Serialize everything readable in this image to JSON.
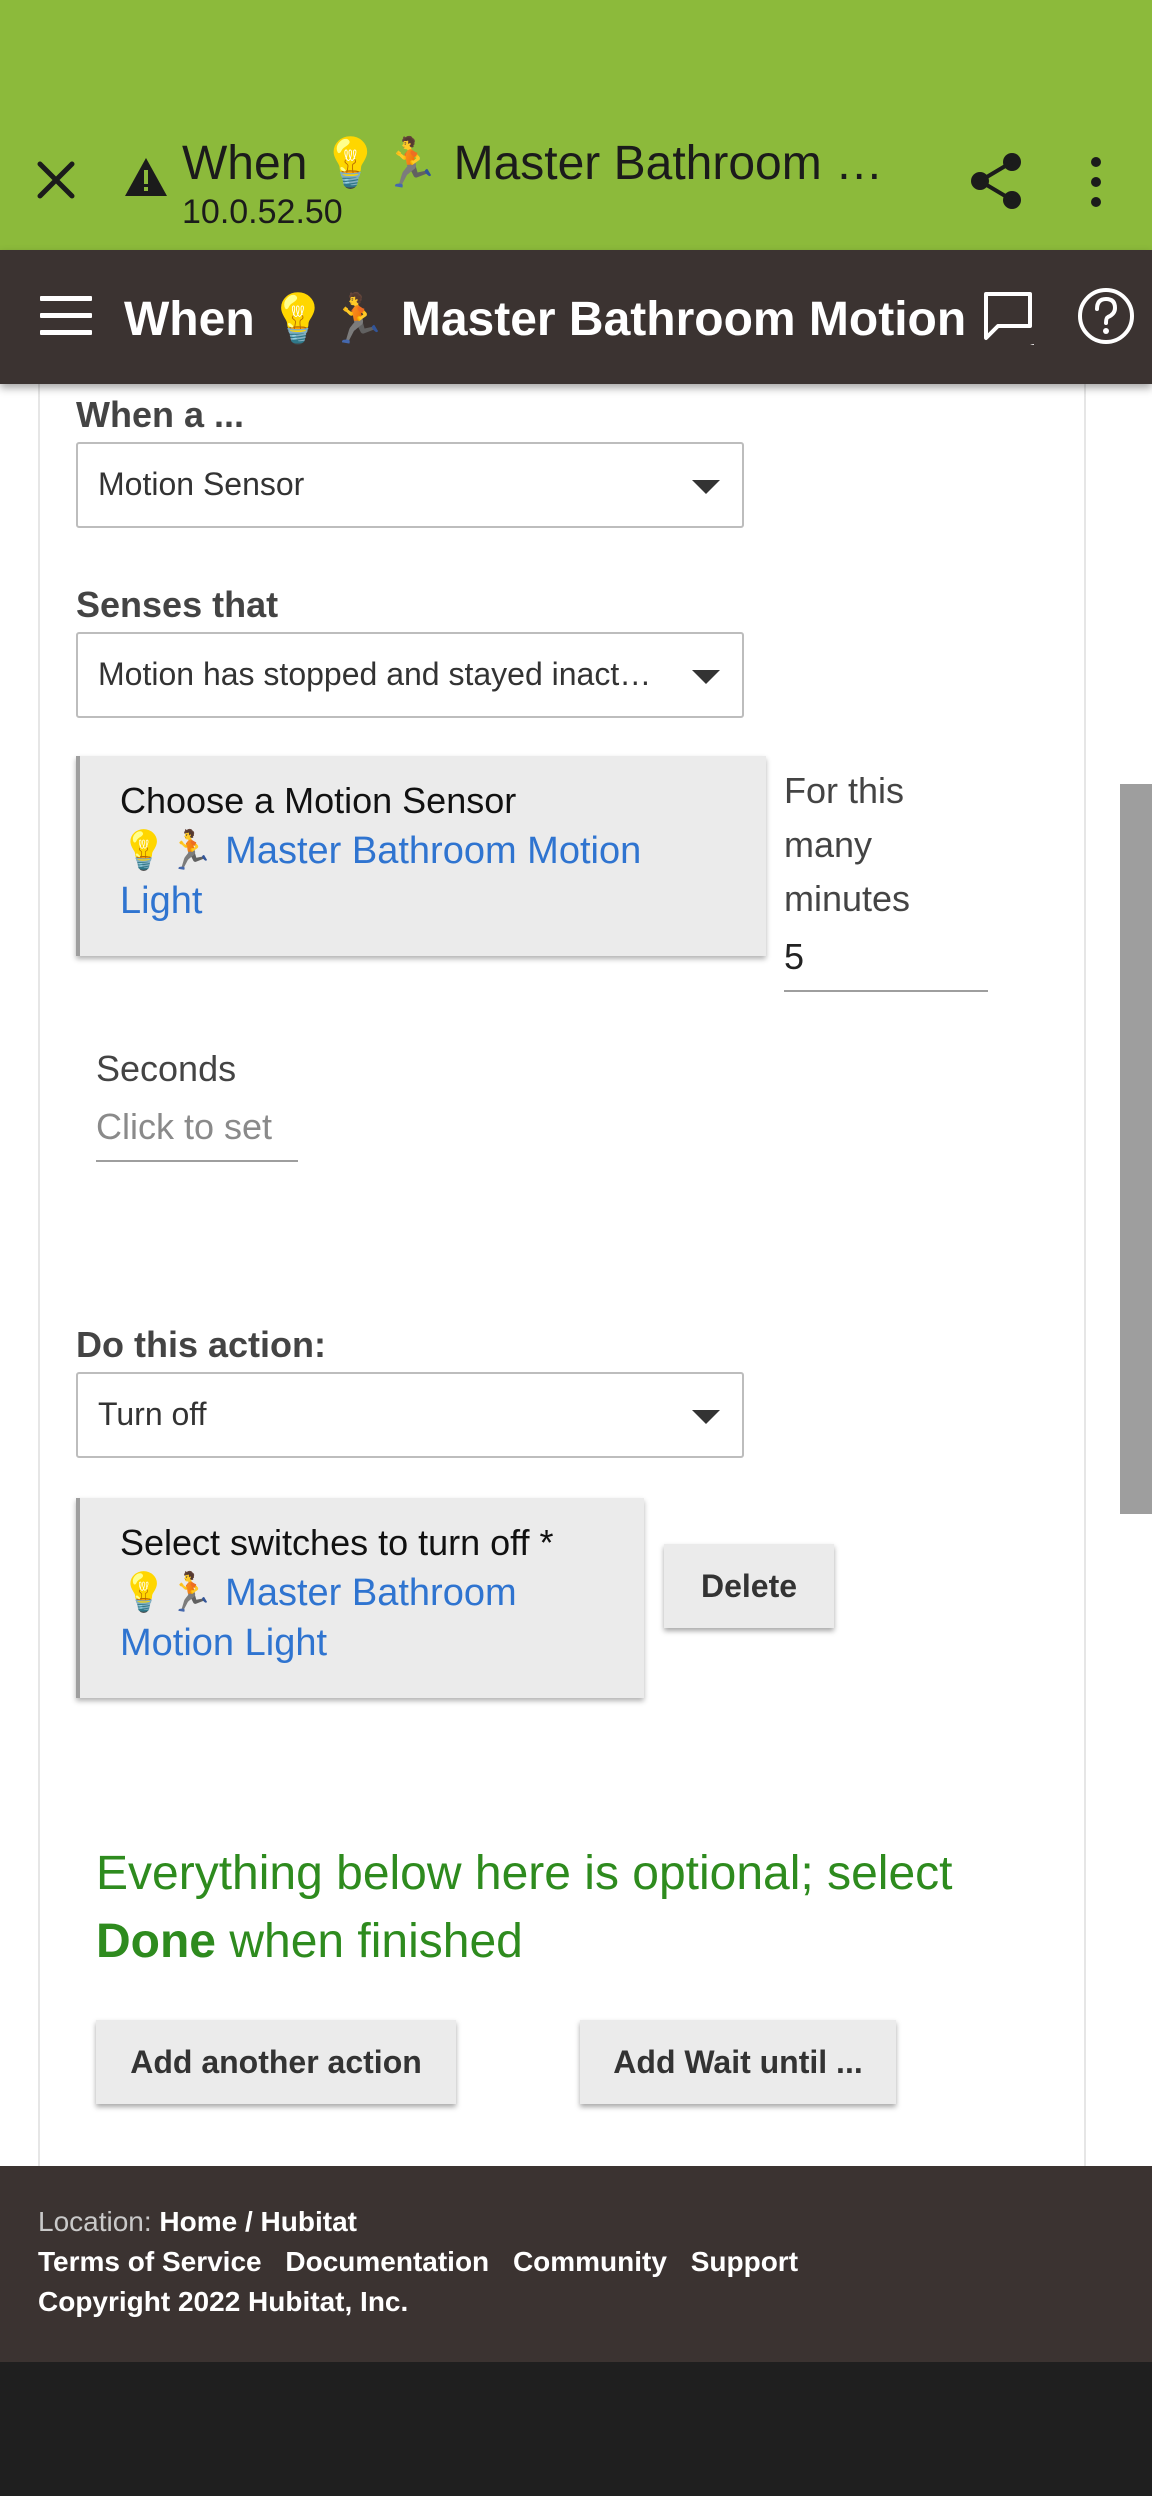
{
  "browser": {
    "title": "When 💡🏃 Master Bathroom Motion Light",
    "url": "10.0.52.50"
  },
  "header": {
    "title": "When 💡🏃 Master Bathroom Motion Light"
  },
  "trigger": {
    "when_label": "When a ...",
    "device_type_value": "Motion Sensor",
    "senses_label": "Senses that",
    "senses_value": "Motion has stopped and stayed inactive",
    "device_box_title": "Choose a Motion Sensor",
    "device_box_value": "💡🏃 Master Bathroom Motion Light",
    "minutes_label": "For this many minutes",
    "minutes_value": "5",
    "seconds_label": "Seconds",
    "seconds_placeholder": "Click to set"
  },
  "action": {
    "label": "Do this action:",
    "value": "Turn off",
    "device_box_title": "Select switches to turn off *",
    "device_box_value": "💡🏃 Master Bathroom Motion Light",
    "delete_label": "Delete"
  },
  "optional": {
    "text_before": "Everything below here is optional; select ",
    "text_bold": "Done",
    "text_after": " when finished"
  },
  "buttons": {
    "add_action": "Add another action",
    "add_wait": "Add Wait until ..."
  },
  "footer": {
    "location_label": "Location: ",
    "location_value": "Home / Hubitat",
    "links": [
      "Terms of Service",
      "Documentation",
      "Community",
      "Support"
    ],
    "copyright": "Copyright 2022 Hubitat, Inc."
  },
  "colors": {
    "browser_bar": "#8cba3b",
    "header_bg": "#3b3331",
    "link": "#2f74d0",
    "optional_text": "#2e8b1e"
  },
  "icons": [
    "close-icon",
    "warning-icon",
    "share-icon",
    "more-vert-icon",
    "menu-icon",
    "feedback-icon",
    "help-icon",
    "dropdown-caret-icon"
  ]
}
